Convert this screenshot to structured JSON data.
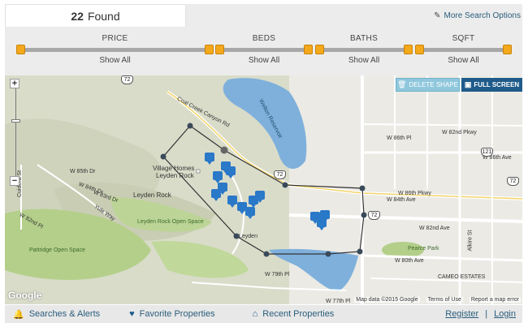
{
  "results": {
    "count": "22",
    "label": "Found"
  },
  "more_search": {
    "label": "More Search Options",
    "icon": "edit-icon"
  },
  "filters": [
    {
      "name": "PRICE",
      "value": "Show All"
    },
    {
      "name": "BEDS",
      "value": "Show All"
    },
    {
      "name": "BATHS",
      "value": "Show All"
    },
    {
      "name": "SQFT",
      "value": "Show All"
    }
  ],
  "map": {
    "buttons": {
      "delete_shape": "DELETE SHAPE",
      "full_screen": "FULL SCREEN"
    },
    "zoom": {
      "in": "+",
      "out": "−"
    },
    "labels": {
      "coal_creek": "Coal Creek Canyon Rd",
      "welton": "Welton Reservoir",
      "village_homes": "Village Homes",
      "leyden_rock_top": "Leyden Rock",
      "leyden_rock": "Leyden Rock",
      "leyden_open_space": "Leyden Rock Open Space",
      "pattridge": "Pattridge Open Space",
      "pearce_park": "Pearce Park",
      "cameo": "CAMEO ESTATES",
      "w85th": "W 85th Dr",
      "w84th": "W 84th Dr",
      "w83rd": "W 83rd Dr",
      "w82nd_pl": "W 82nd Pl",
      "w86th_pl": "W 86th Pl",
      "w86th_ave": "W 86th Ave",
      "w84th_ave": "W 84th Ave",
      "w82nd_ave": "W 82nd Ave",
      "w80th_ave": "W 80th Ave",
      "w79th": "W 79th Pl",
      "w77th": "W 77th Pl",
      "w82nd_pkwy": "W 82nd Pkwy",
      "w86th_pkwy": "W 86th Pkwy",
      "leyden": "Leyden",
      "yule": "Yule Way",
      "cuidera": "Cuidera St",
      "alkire": "Alkire St"
    },
    "highways": [
      "72",
      "72",
      "72",
      "121",
      "72"
    ],
    "footer": {
      "data": "Map data ©2015 Google",
      "terms": "Terms of Use",
      "report": "Report a map error"
    },
    "google": "Google",
    "colors": {
      "water": "#7fb0dc",
      "park": "#b4cf8a",
      "terrain": "#d9dcc9",
      "road": "#ffffff",
      "marker": "#2a78c8"
    }
  },
  "bottom": {
    "searches": "Searches & Alerts",
    "favorites": "Favorite Properties",
    "recent": "Recent Properties",
    "register": "Register",
    "separator": "|",
    "login": "Login"
  }
}
